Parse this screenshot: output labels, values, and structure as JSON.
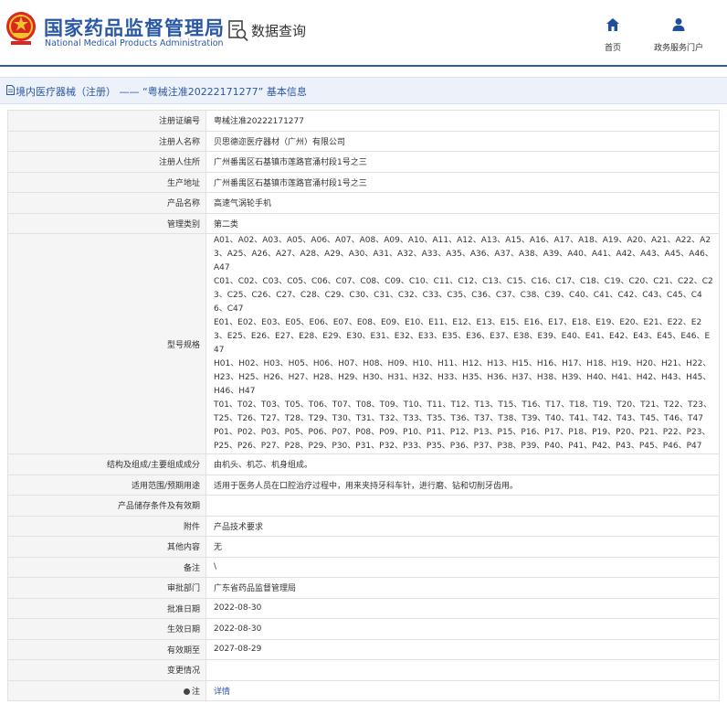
{
  "header": {
    "site_title_cn": "国家药品监督管理局",
    "site_title_en": "National Medical Products Administration",
    "query_label": "数据查询",
    "nav": [
      {
        "label": "首页",
        "icon": "home-icon"
      },
      {
        "label": "政务服务门户",
        "icon": "user-icon"
      }
    ]
  },
  "breadcrumb": {
    "text": "境内医疗器械（注册） —— “粤械注准20222171277” 基本信息"
  },
  "colors": {
    "brand": "#2b58a6",
    "label_bg": "#f5f5f5",
    "breadcrumb_bg": "#edf2fa"
  },
  "fields": {
    "reg_no": {
      "label": "注册证编号",
      "value": "粤械注准20222171277"
    },
    "registrant": {
      "label": "注册人名称",
      "value": "贝思德迩医疗器材（广州）有限公司"
    },
    "registrant_address": {
      "label": "注册人住所",
      "value": "广州番禺区石基镇市莲路官涌村段1号之三"
    },
    "production_address": {
      "label": "生产地址",
      "value": "广州番禺区石基镇市莲路官涌村段1号之三"
    },
    "product_name": {
      "label": "产品名称",
      "value": "高速气涡轮手机"
    },
    "category": {
      "label": "管理类别",
      "value": "第二类"
    },
    "models": {
      "label": "型号规格",
      "lines": [
        "A01、A02、A03、A05、A06、A07、A08、A09、A10、A11、A12、A13、A15、A16、A17、A18、A19、A20、A21、A22、A23、A25、A26、A27、A28、A29、A30、A31、A32、A33、A35、A36、A37、A38、A39、A40、A41、A42、A43、A45、A46、A47",
        "C01、C02、C03、C05、C06、C07、C08、C09、C10、C11、C12、C13、C15、C16、C17、C18、C19、C20、C21、C22、C23、C25、C26、C27、C28、C29、C30、C31、C32、C33、C35、C36、C37、C38、C39、C40、C41、C42、C43、C45、C46、C47",
        "E01、E02、E03、E05、E06、E07、E08、E09、E10、E11、E12、E13、E15、E16、E17、E18、E19、E20、E21、E22、E23、E25、E26、E27、E28、E29、E30、E31、E32、E33、E35、E36、E37、E38、E39、E40、E41、E42、E43、E45、E46、E47",
        "H01、H02、H03、H05、H06、H07、H08、H09、H10、H11、H12、H13、H15、H16、H17、H18、H19、H20、H21、H22、H23、H25、H26、H27、H28、H29、H30、H31、H32、H33、H35、H36、H37、H38、H39、H40、H41、H42、H43、H45、H46、H47",
        "T01、T02、T03、T05、T06、T07、T08、T09、T10、T11、T12、T13、T15、T16、T17、T18、T19、T20、T21、T22、T23、T25、T26、T27、T28、T29、T30、T31、T32、T33、T35、T36、T37、T38、T39、T40、T41、T42、T43、T45、T46、T47",
        "P01、P02、P03、P05、P06、P07、P08、P09、P10、P11、P12、P13、P15、P16、P17、P18、P19、P20、P21、P22、P23、P25、P26、P27、P28、P29、P30、P31、P32、P33、P35、P36、P37、P38、P39、P40、P41、P42、P43、P45、P46、P47"
      ]
    },
    "structure": {
      "label": "结构及组成/主要组成成分",
      "value": "由机头、机芯、机身组成。"
    },
    "scope": {
      "label": "适用范围/预期用途",
      "value": "适用于医务人员在口腔治疗过程中，用来夹持牙科车针，进行磨、钻和切削牙齿用。"
    },
    "storage": {
      "label": "产品储存条件及有效期",
      "value": ""
    },
    "attachment": {
      "label": "附件",
      "value": "产品技术要求"
    },
    "other": {
      "label": "其他内容",
      "value": "无"
    },
    "remark": {
      "label": "备注",
      "value": "\\"
    },
    "approval_dept": {
      "label": "审批部门",
      "value": "广东省药品监督管理局"
    },
    "approval_date": {
      "label": "批准日期",
      "value": "2022-08-30"
    },
    "effective_date": {
      "label": "生效日期",
      "value": "2022-08-30"
    },
    "valid_until": {
      "label": "有效期至",
      "value": "2027-08-29"
    },
    "change": {
      "label": "变更情况",
      "value": ""
    },
    "note": {
      "label": "注",
      "value": "详情"
    }
  }
}
